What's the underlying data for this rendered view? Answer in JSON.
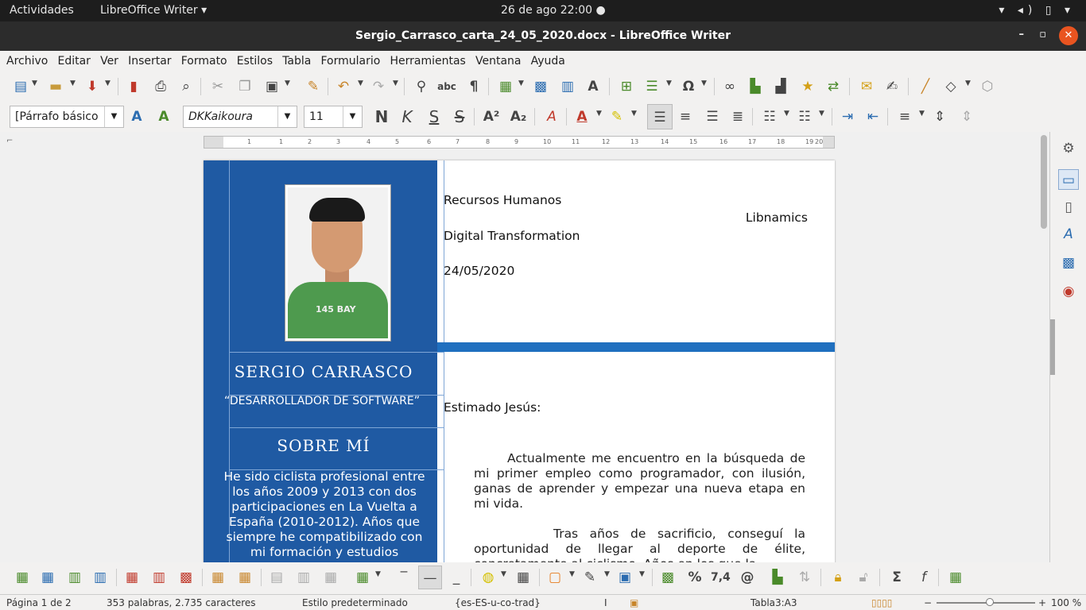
{
  "topbar": {
    "activities": "Actividades",
    "app": "LibreOffice Writer ▾",
    "clock": "26 de ago  22:00  ●",
    "tray": "▾ ◂) ▯ ▾"
  },
  "window": {
    "title": "Sergio_Carrasco_carta_24_05_2020.docx - LibreOffice Writer",
    "min": "–",
    "max": "▫",
    "close": "✕"
  },
  "menu": [
    "Archivo",
    "Editar",
    "Ver",
    "Insertar",
    "Formato",
    "Estilos",
    "Tabla",
    "Formulario",
    "Herramientas",
    "Ventana",
    "Ayuda"
  ],
  "format": {
    "paragraph_style": "[Párrafo básico",
    "font": "DKKaikoura",
    "size": "11"
  },
  "ruler": [
    "1",
    "1",
    "2",
    "3",
    "4",
    "5",
    "6",
    "7",
    "8",
    "9",
    "10",
    "11",
    "12",
    "13",
    "14",
    "15",
    "16",
    "17",
    "18",
    "19",
    "20"
  ],
  "sidebar_panel": {
    "name": "SERGIO  CARRASCO",
    "role": "“DESARROLLADOR DE SOFTWARE”",
    "about_heading": "SOBRE MÍ",
    "about_text": "He sido ciclista profesional entre los años 2009 y 2013 con dos participaciones en La Vuelta a España (2010-2012). Años que siempre he compatibilizado con mi formación y estudios",
    "photo_text": "145 BAY"
  },
  "letter": {
    "dept": "Recursos Humanos",
    "company": "Libnamics",
    "area": "Digital Transformation",
    "date": "24/05/2020",
    "greeting": "Estimado Jesús:",
    "para1": "Actualmente me encuentro en la búsqueda de mi primer empleo como programador, con ilusión, ganas de aprender y empezar una nueva etapa en mi vida.",
    "para2": "Tras años de sacrificio, conseguí la oportunidad de llegar al deporte de élite, concretamente al ciclismo. Años en los que la"
  },
  "status": {
    "page": "Página 1 de 2",
    "words": "353 palabras, 2.735 caracteres",
    "style": "Estilo predeterminado",
    "lang": "{es-ES-u-co-trad}",
    "cell": "Tabla3:A3",
    "zoom": "100 %"
  }
}
